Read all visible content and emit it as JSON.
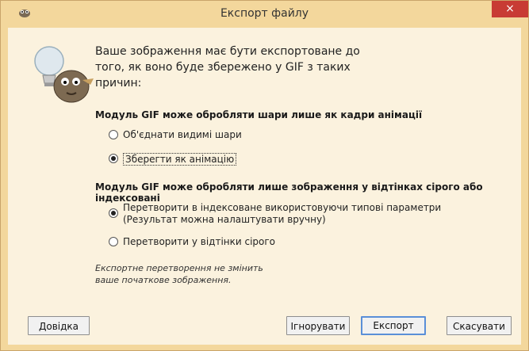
{
  "window": {
    "title": "Експорт файлу",
    "close_label": "×"
  },
  "intro_text": "Ваше зображення має бути експортоване до\nтого, як воно буде збережено у GIF з таких\nпричин:",
  "section_layers": {
    "heading": "Модуль GIF може обробляти шари лише як кадри анімації",
    "options": [
      {
        "label": "Об'єднати видимі шари",
        "checked": false
      },
      {
        "label": "Зберегти як анімацію",
        "checked": true
      }
    ]
  },
  "section_color": {
    "heading": "Модуль GIF може обробляти лише зображення у відтінках сірого або індексовані",
    "options": [
      {
        "label": "Перетворити в індексоване використовуючи типові параметри\n(Результат можна налаштувати вручну)",
        "checked": true
      },
      {
        "label": "Перетворити у відтінки сірого",
        "checked": false
      }
    ]
  },
  "note": "Експортне перетворення не змінить\nваше початкове зображення.",
  "buttons": {
    "help": "Довідка",
    "ignore": "Ігнорувати",
    "export": "Експорт",
    "cancel": "Скасувати"
  },
  "icons": {
    "app": "gimp-icon",
    "illustration": "wilber-lightbulb-icon"
  }
}
